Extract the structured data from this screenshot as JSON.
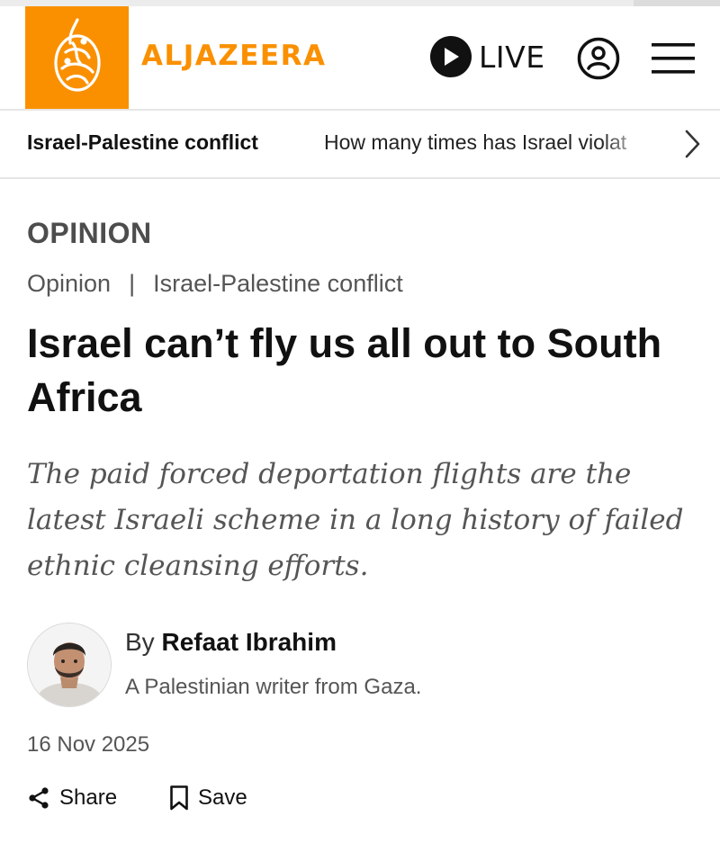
{
  "header": {
    "logo_text": "ALJAZEERA",
    "logo_icon": "aljazeera-calligraphy-logo",
    "live_label": "LIVE",
    "brand_color": "#fa9000"
  },
  "topic_bar": {
    "primary": "Israel-Palestine conflict",
    "secondary": "How many times has Israel violat"
  },
  "article": {
    "section": "OPINION",
    "breadcrumb": [
      "Opinion",
      "|",
      "Israel-Palestine conflict"
    ],
    "headline": "Israel can’t fly us all out to South Africa",
    "standfirst": "The paid forced deportation flights are the latest Israeli scheme in a long history of failed ethnic cleansing efforts.",
    "byline_prefix": "By",
    "author": "Refaat Ibrahim",
    "author_bio": "A Palestinian writer from Gaza.",
    "date": "16 Nov 2025"
  },
  "actions": {
    "share_label": "Share",
    "save_label": "Save"
  }
}
